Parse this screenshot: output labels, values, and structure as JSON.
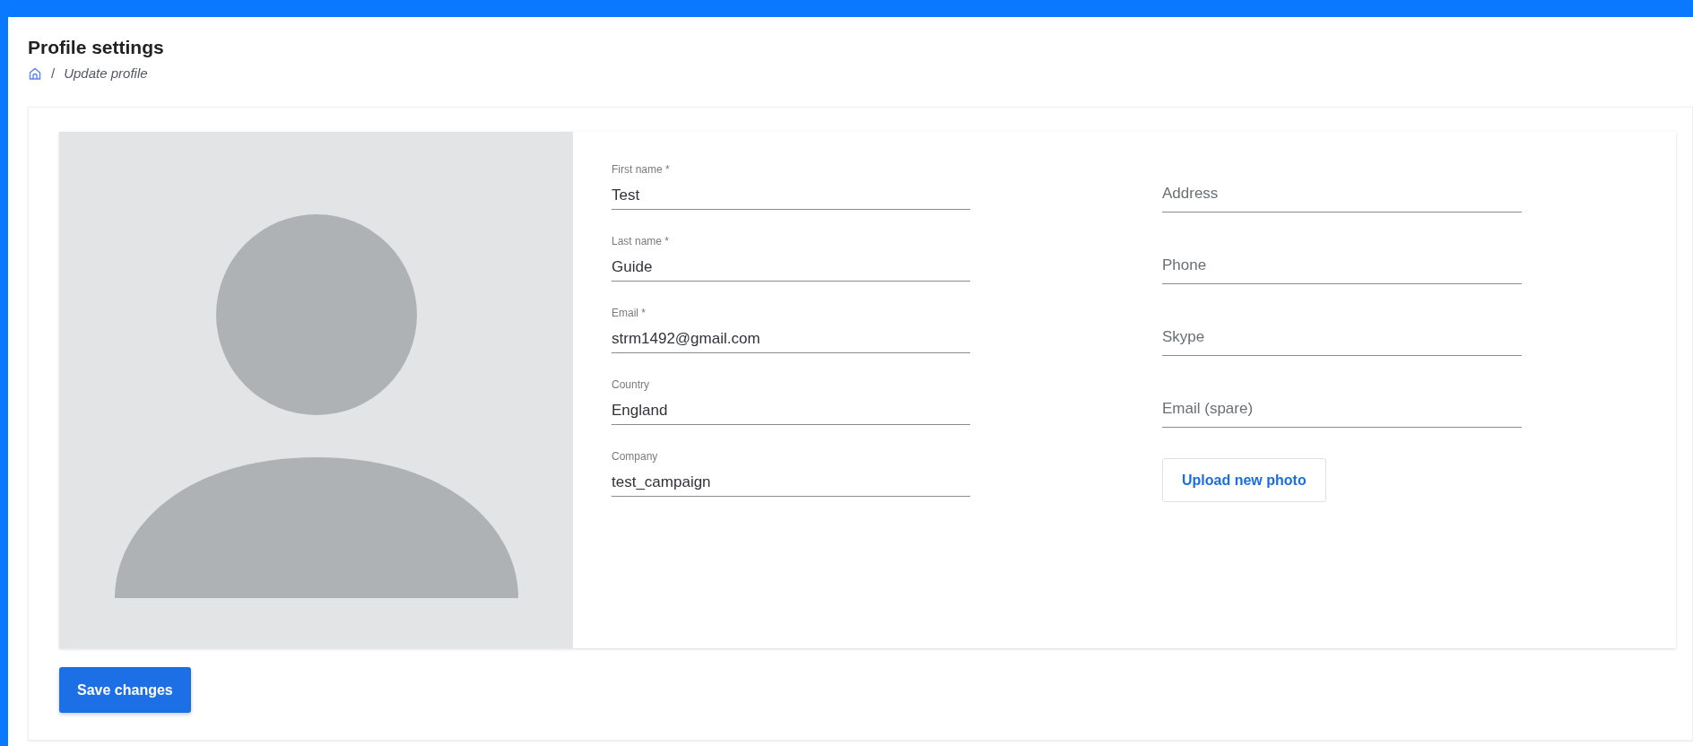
{
  "header": {
    "title": "Profile settings",
    "breadcrumb": [
      {
        "kind": "home"
      },
      {
        "kind": "separator",
        "label": "/"
      },
      {
        "kind": "text",
        "label": "Update profile"
      }
    ]
  },
  "left_fields": [
    {
      "label": "First name *",
      "value": "Test"
    },
    {
      "label": "Last name *",
      "value": "Guide"
    },
    {
      "label": "Email *",
      "value": "strm1492@gmail.com"
    },
    {
      "label": "Country",
      "value": "England"
    },
    {
      "label": "Company",
      "value": "test_campaign"
    }
  ],
  "right_fields": [
    {
      "placeholder": "Address"
    },
    {
      "placeholder": "Phone"
    },
    {
      "placeholder": "Skype"
    },
    {
      "placeholder": "Email (spare)"
    }
  ],
  "upload_button": "Upload new photo",
  "save_button": "Save changes"
}
